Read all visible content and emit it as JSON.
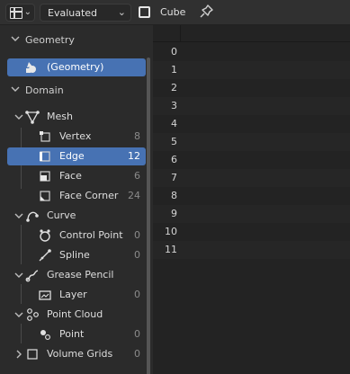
{
  "header": {
    "eval_mode": "Evaluated",
    "object_name": "Cube"
  },
  "sidebar": {
    "geometry_section": "Geometry",
    "geometry_item": "(Geometry)",
    "domain_section": "Domain",
    "items": [
      {
        "label": "Mesh",
        "count": ""
      },
      {
        "label": "Vertex",
        "count": "8"
      },
      {
        "label": "Edge",
        "count": "12"
      },
      {
        "label": "Face",
        "count": "6"
      },
      {
        "label": "Face Corner",
        "count": "24"
      },
      {
        "label": "Curve",
        "count": ""
      },
      {
        "label": "Control Point",
        "count": "0"
      },
      {
        "label": "Spline",
        "count": "0"
      },
      {
        "label": "Grease Pencil",
        "count": ""
      },
      {
        "label": "Layer",
        "count": "0"
      },
      {
        "label": "Point Cloud",
        "count": ""
      },
      {
        "label": "Point",
        "count": "0"
      },
      {
        "label": "Volume Grids",
        "count": "0"
      }
    ]
  },
  "spreadsheet": {
    "row_indices": [
      "0",
      "1",
      "2",
      "3",
      "4",
      "5",
      "6",
      "7",
      "8",
      "9",
      "10",
      "11"
    ]
  },
  "colors": {
    "selected": "#4772b3"
  }
}
